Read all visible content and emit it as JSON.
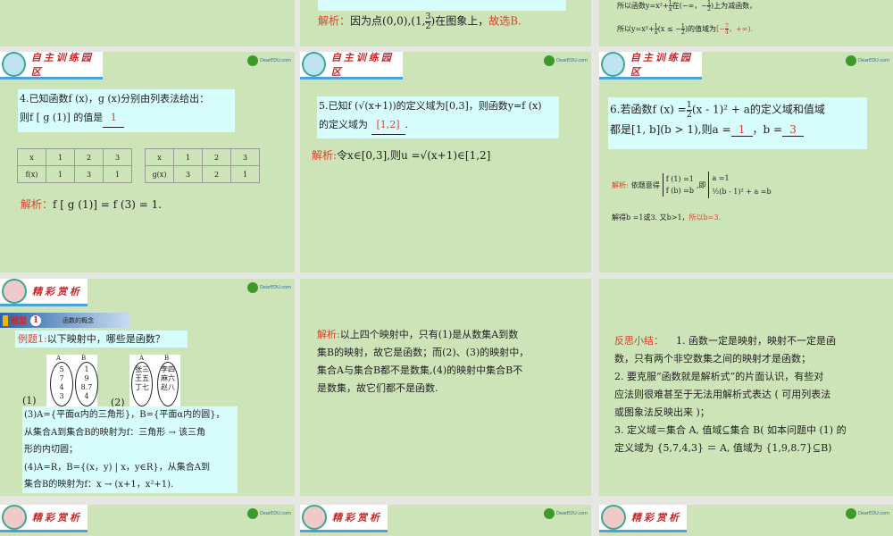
{
  "banners": {
    "training": "自主训练园区",
    "appreciation": "精彩赏析"
  },
  "logo_text": "DearEDU.com",
  "s1b": {
    "analysis_label": "解析：",
    "text": "因为点(0,0),(1,",
    "frac_num": "3",
    "frac_den": "2",
    "text2": ")在图象上，",
    "conclusion": "故选B."
  },
  "s1c": {
    "line1a": "所以函数y=x²+",
    "f1n": "1",
    "f1d": "x",
    "line1b": "在(−∞，−",
    "f2n": "1",
    "f2d": "2",
    "line1c": ")上为减函数，",
    "line2a": "所以y=x²+",
    "line2b": "(x ≤ −",
    "line2c": ")的值域为",
    "range_a": "[−",
    "r_n": "7",
    "r_d": "4",
    "range_b": "，+∞)."
  },
  "s4": {
    "q_line1": "4.已知函数f (x)，g (x)分别由列表法给出：",
    "q_line2": "则f [ g (1)] 的值是",
    "answer": "1",
    "table1": {
      "rows": [
        [
          "x",
          "1",
          "2",
          "3"
        ],
        [
          "f(x)",
          "1",
          "3",
          "1"
        ]
      ]
    },
    "table2": {
      "rows": [
        [
          "x",
          "1",
          "2",
          "3"
        ],
        [
          "g(x)",
          "3",
          "2",
          "1"
        ]
      ]
    },
    "analysis_label": "解析：",
    "analysis": "f [ g (1)] = f (3) = 1."
  },
  "s5": {
    "q_line1": "5.已知f (√(x+1))的定义域为[0,3]，则函数y=f (x)",
    "q_line2": "的定义域为",
    "answer": "[1,2]",
    "q_end": ".",
    "analysis_label": "解析:",
    "analysis": "令x∈[0,3],则u =√(x+1)∈[1,2]"
  },
  "s6": {
    "q_line1a": "6.若函数f (x) =",
    "fn": "1",
    "fd": "2",
    "q_line1b": "(x - 1)² + a的定义域和值域",
    "q_line2": "都是[1, b](b > 1),则a =",
    "a_answer": "1",
    "b_label": "，b =",
    "b_answer": "3",
    "analysis_label": "解析:",
    "analysis_a": "依题意得",
    "sys1": [
      "f (1) =1",
      "f (b) =b"
    ],
    "ji": ",即",
    "sys2": [
      "a =1",
      "½(b - 1)² + a =b"
    ],
    "solve": "解得b =1或3. 又b>1，",
    "solve_red": "所以b=3."
  },
  "s7": {
    "type_tag": "题型",
    "type_num": "1",
    "type_title": "函数的概念",
    "example_label": "例题1:",
    "example_q": "以下映射中，哪些是函数？",
    "d1_label": "(1)",
    "d2_label": "(2)",
    "d1_A": [
      "5",
      "7",
      "4",
      "3"
    ],
    "d1_B": [
      "1",
      "9",
      "8.7",
      "4"
    ],
    "d2_A": [
      "张三",
      "王五",
      "丁七"
    ],
    "d2_B": [
      "李四",
      "麻六",
      "赵八"
    ],
    "setA": "A",
    "setB": "B",
    "lines": [
      "(3)A={平面α内的三角形}，B={平面α内的圆}，",
      "从集合A到集合B的映射为f：三角形 → 该三角",
      "形的内切圆；",
      "(4)A=R，B={(x，y) | x，y∈R}，从集合A到",
      "集合B的映射为f：x → (x+1，x²+1)."
    ]
  },
  "s8": {
    "analysis_label": "解析:",
    "lines": [
      "以上四个映射中，只有(1)是从数集A到数",
      "集B的映射，故它是函数；而(2)、(3)的映射中，",
      "集合A与集合B都不是数集,(4)的映射中集合B不",
      "是数集，故它们都不是函数."
    ]
  },
  "s9": {
    "label": "反思小结：",
    "lines": [
      "1. 函数一定是映射，映射不一定是函",
      "数，只有两个非空数集之间的映射才是函数；",
      "2. 要克服“函数就是解析式”的片面认识，有些对",
      "应法则很难甚至于无法用解析式表达 ( 可用列表法",
      "或图象法反映出来 )；",
      "3. 定义域＝集合 A, 值域⊆集合 B( 如本问题中 (1) 的",
      "定义域为 {5,7,4,3} ＝ A, 值域为 {1,9,8.7}⊆B)"
    ]
  }
}
